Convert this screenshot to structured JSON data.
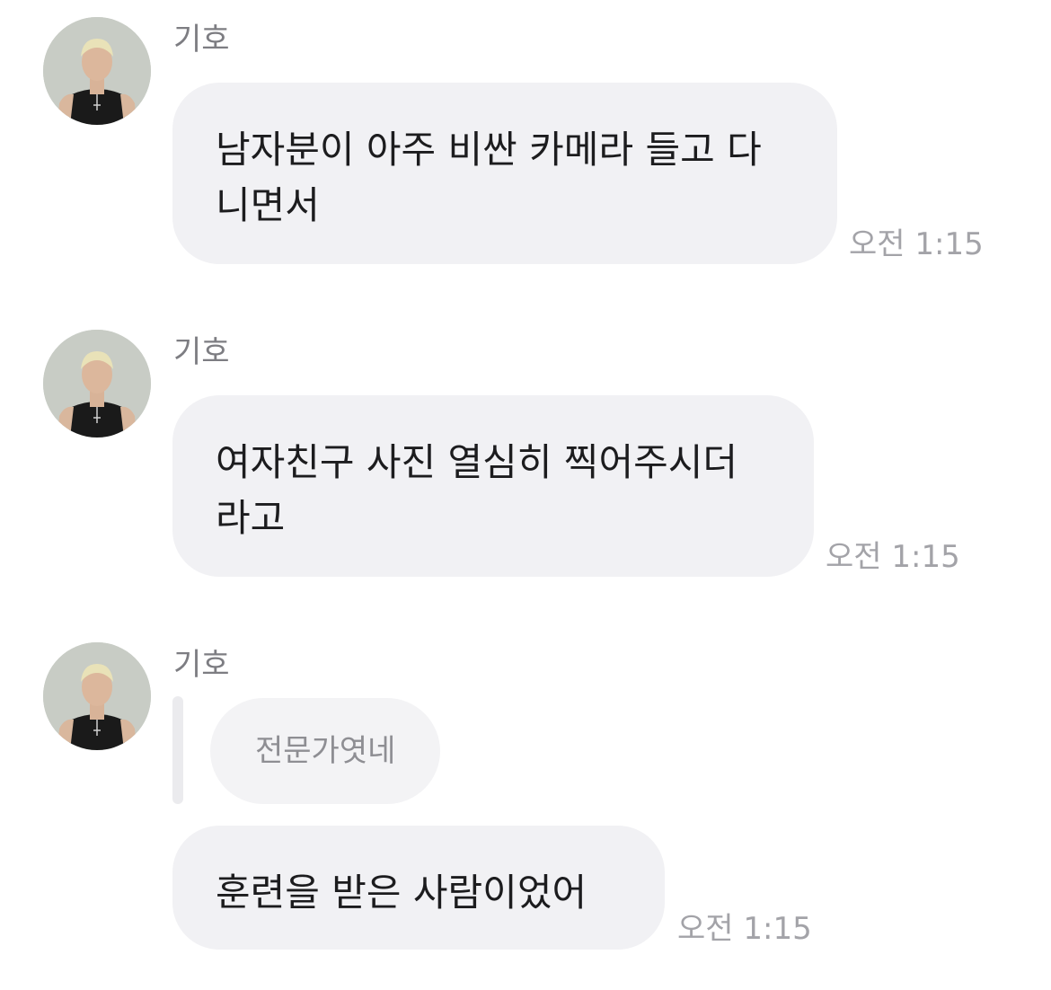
{
  "messages": [
    {
      "sender": "기호",
      "text": "남자분이 아주 비싼 카메라 들고 다\n니면서",
      "time": "오전 1:15"
    },
    {
      "sender": "기호",
      "text": "여자친구 사진 열심히 찍어주시더\n라고",
      "time": "오전 1:15"
    },
    {
      "sender": "기호",
      "reply": "전문가엿네",
      "text": "훈련을 받은 사람이었어",
      "time": "오전 1:15"
    }
  ],
  "colors": {
    "bubble": "#f1f1f4",
    "text": "#1c1c1e",
    "sender": "#7d7d82",
    "timestamp": "#a3a3a8"
  }
}
